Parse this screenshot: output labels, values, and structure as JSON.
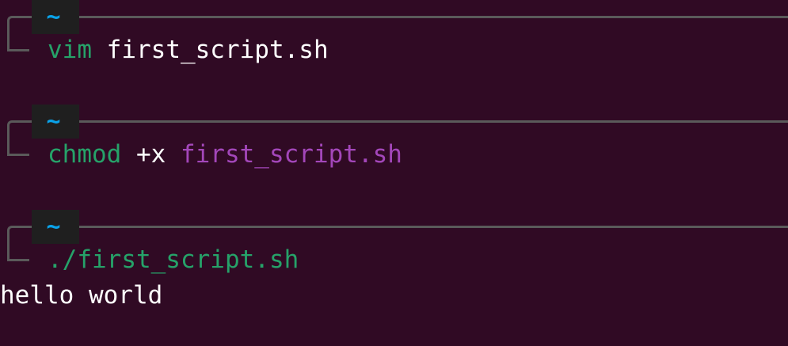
{
  "colors": {
    "background": "#300a24",
    "frame": "#5a5a5a",
    "badge_bg": "#1f1f1f",
    "dir": "#0aa2e8",
    "command": "#26a269",
    "text": "#ffffff",
    "file_arg": "#a347ba"
  },
  "prompts": [
    {
      "dir": "~",
      "command": "vim",
      "args": " first_script.sh"
    },
    {
      "dir": "~",
      "command": "chmod",
      "flag": " +x ",
      "file": "first_script.sh"
    },
    {
      "dir": "~",
      "command": "./first_script.sh"
    }
  ],
  "output": "hello world"
}
